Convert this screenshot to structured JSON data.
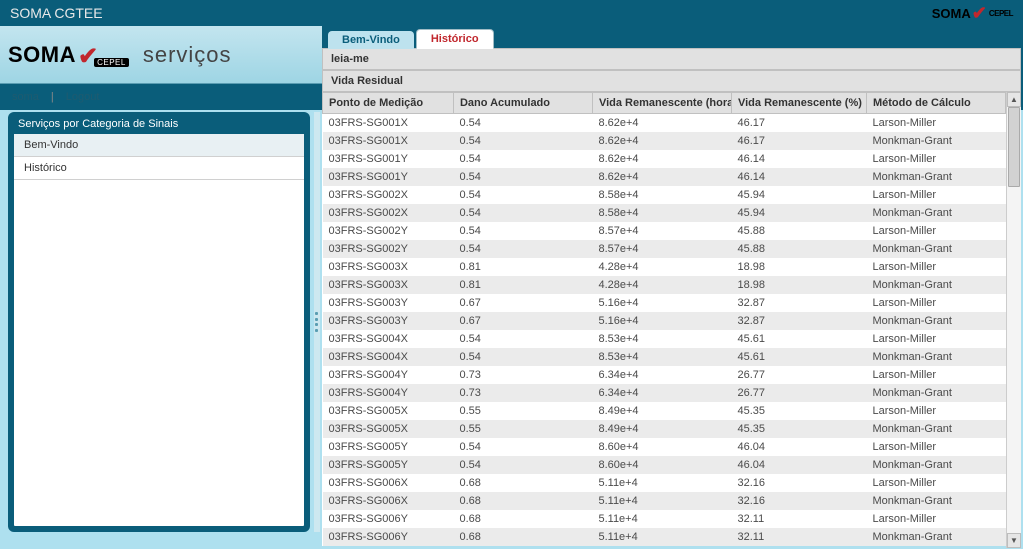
{
  "topbar": {
    "title": "SOMA CGTEE"
  },
  "brand": {
    "soma": "SOMA",
    "cepel": "CEPEL",
    "services": "serviços"
  },
  "user_strip": {
    "user": "soma",
    "separator": "|",
    "logout": "Logout"
  },
  "left_panel": {
    "title": "Serviços por Categoria de Sinais",
    "items": [
      {
        "label": "Bem-Vindo"
      },
      {
        "label": "Histórico"
      }
    ]
  },
  "tabs": [
    {
      "label": "Bem-Vindo",
      "active": false
    },
    {
      "label": "Histórico",
      "active": true
    }
  ],
  "section_leia_me": "leia-me",
  "section_vida": "Vida Residual",
  "table": {
    "headers": [
      "Ponto de Medição",
      "Dano Acumulado",
      "Vida Remanescente (horas)",
      "Vida Remanescente (%)",
      "Método de Cálculo"
    ],
    "rows": [
      [
        "03FRS-SG001X",
        "0.54",
        "8.62e+4",
        "46.17",
        "Larson-Miller"
      ],
      [
        "03FRS-SG001X",
        "0.54",
        "8.62e+4",
        "46.17",
        "Monkman-Grant"
      ],
      [
        "03FRS-SG001Y",
        "0.54",
        "8.62e+4",
        "46.14",
        "Larson-Miller"
      ],
      [
        "03FRS-SG001Y",
        "0.54",
        "8.62e+4",
        "46.14",
        "Monkman-Grant"
      ],
      [
        "03FRS-SG002X",
        "0.54",
        "8.58e+4",
        "45.94",
        "Larson-Miller"
      ],
      [
        "03FRS-SG002X",
        "0.54",
        "8.58e+4",
        "45.94",
        "Monkman-Grant"
      ],
      [
        "03FRS-SG002Y",
        "0.54",
        "8.57e+4",
        "45.88",
        "Larson-Miller"
      ],
      [
        "03FRS-SG002Y",
        "0.54",
        "8.57e+4",
        "45.88",
        "Monkman-Grant"
      ],
      [
        "03FRS-SG003X",
        "0.81",
        "4.28e+4",
        "18.98",
        "Larson-Miller"
      ],
      [
        "03FRS-SG003X",
        "0.81",
        "4.28e+4",
        "18.98",
        "Monkman-Grant"
      ],
      [
        "03FRS-SG003Y",
        "0.67",
        "5.16e+4",
        "32.87",
        "Larson-Miller"
      ],
      [
        "03FRS-SG003Y",
        "0.67",
        "5.16e+4",
        "32.87",
        "Monkman-Grant"
      ],
      [
        "03FRS-SG004X",
        "0.54",
        "8.53e+4",
        "45.61",
        "Larson-Miller"
      ],
      [
        "03FRS-SG004X",
        "0.54",
        "8.53e+4",
        "45.61",
        "Monkman-Grant"
      ],
      [
        "03FRS-SG004Y",
        "0.73",
        "6.34e+4",
        "26.77",
        "Larson-Miller"
      ],
      [
        "03FRS-SG004Y",
        "0.73",
        "6.34e+4",
        "26.77",
        "Monkman-Grant"
      ],
      [
        "03FRS-SG005X",
        "0.55",
        "8.49e+4",
        "45.35",
        "Larson-Miller"
      ],
      [
        "03FRS-SG005X",
        "0.55",
        "8.49e+4",
        "45.35",
        "Monkman-Grant"
      ],
      [
        "03FRS-SG005Y",
        "0.54",
        "8.60e+4",
        "46.04",
        "Larson-Miller"
      ],
      [
        "03FRS-SG005Y",
        "0.54",
        "8.60e+4",
        "46.04",
        "Monkman-Grant"
      ],
      [
        "03FRS-SG006X",
        "0.68",
        "5.11e+4",
        "32.16",
        "Larson-Miller"
      ],
      [
        "03FRS-SG006X",
        "0.68",
        "5.11e+4",
        "32.16",
        "Monkman-Grant"
      ],
      [
        "03FRS-SG006Y",
        "0.68",
        "5.11e+4",
        "32.11",
        "Larson-Miller"
      ],
      [
        "03FRS-SG006Y",
        "0.68",
        "5.11e+4",
        "32.11",
        "Monkman-Grant"
      ]
    ]
  }
}
